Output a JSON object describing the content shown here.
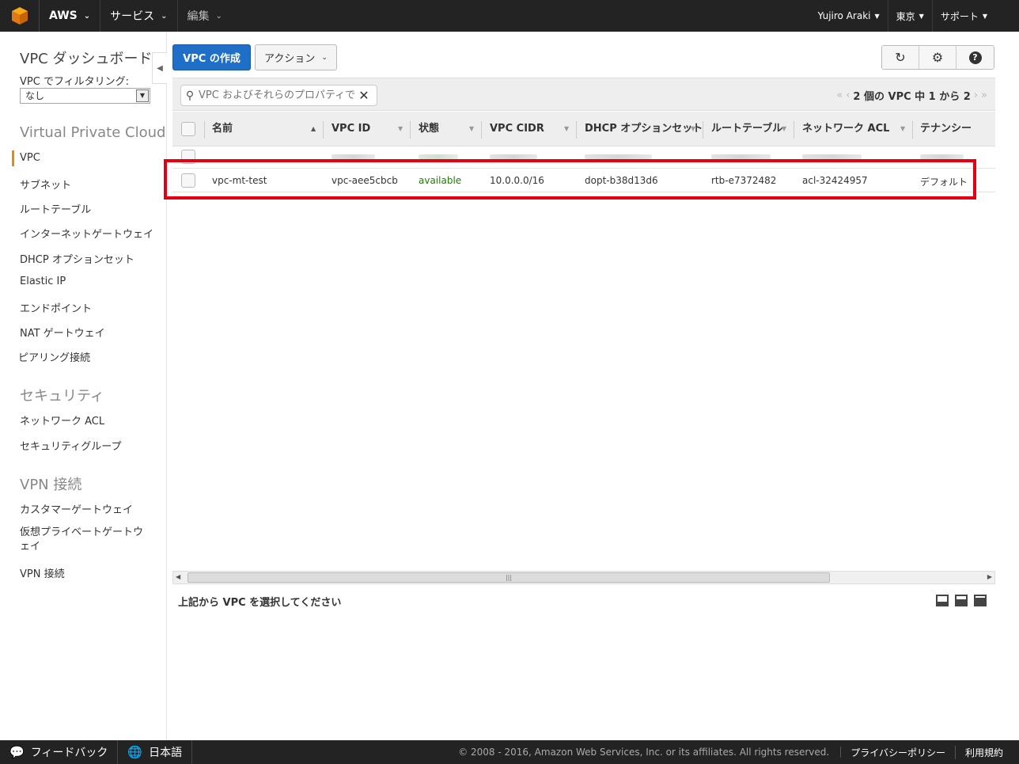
{
  "topnav": {
    "brand": "AWS",
    "services": "サービス",
    "edit": "編集",
    "user": "Yujiro Araki",
    "region": "東京",
    "support": "サポート"
  },
  "sidebar": {
    "title": "VPC ダッシュボード",
    "filter_label": "VPC でフィルタリング:",
    "filter_value": "なし",
    "section_vpc": "Virtual Private Cloud",
    "items_vpc": [
      "VPC",
      "サブネット",
      "ルートテーブル",
      "インターネットゲートウェイ",
      "DHCP オプションセット",
      "Elastic IP",
      "エンドポイント",
      "NAT ゲートウェイ",
      "ピアリング接続"
    ],
    "section_security": "セキュリティ",
    "items_security": [
      "ネットワーク ACL",
      "セキュリティグループ"
    ],
    "section_vpn": "VPN 接続",
    "items_vpn": [
      "カスタマーゲートウェイ",
      "仮想プライベートゲートウェイ",
      "VPN 接続"
    ]
  },
  "toolbar": {
    "create_label": "VPC の作成",
    "actions_label": "アクション",
    "search_placeholder": "VPC およびそれらのプロパティで",
    "pager": "2 個の VPC 中 1 から 2"
  },
  "table": {
    "columns": [
      "名前",
      "VPC ID",
      "状態",
      "VPC CIDR",
      "DHCP オプションセット",
      "ルートテーブル",
      "ネットワーク ACL",
      "テナンシー"
    ],
    "rows": [
      {
        "name": "vpc-mt-test",
        "vpc_id": "vpc-aee5cbcb",
        "state": "available",
        "cidr": "10.0.0.0/16",
        "dhcp": "dopt-b38d13d6",
        "route_table": "rtb-e7372482",
        "acl": "acl-32424957",
        "tenancy": "デフォルト"
      }
    ]
  },
  "detail": {
    "message": "上記から VPC を選択してください"
  },
  "footer": {
    "feedback": "フィードバック",
    "language": "日本語",
    "copyright": "© 2008 - 2016, Amazon Web Services, Inc. or its affiliates. All rights reserved.",
    "privacy": "プライバシーポリシー",
    "terms": "利用規約"
  },
  "colors": {
    "primary": "#1f6ec8",
    "available": "#1d8102",
    "highlight": "#e60012",
    "nav_bg": "#232323"
  }
}
